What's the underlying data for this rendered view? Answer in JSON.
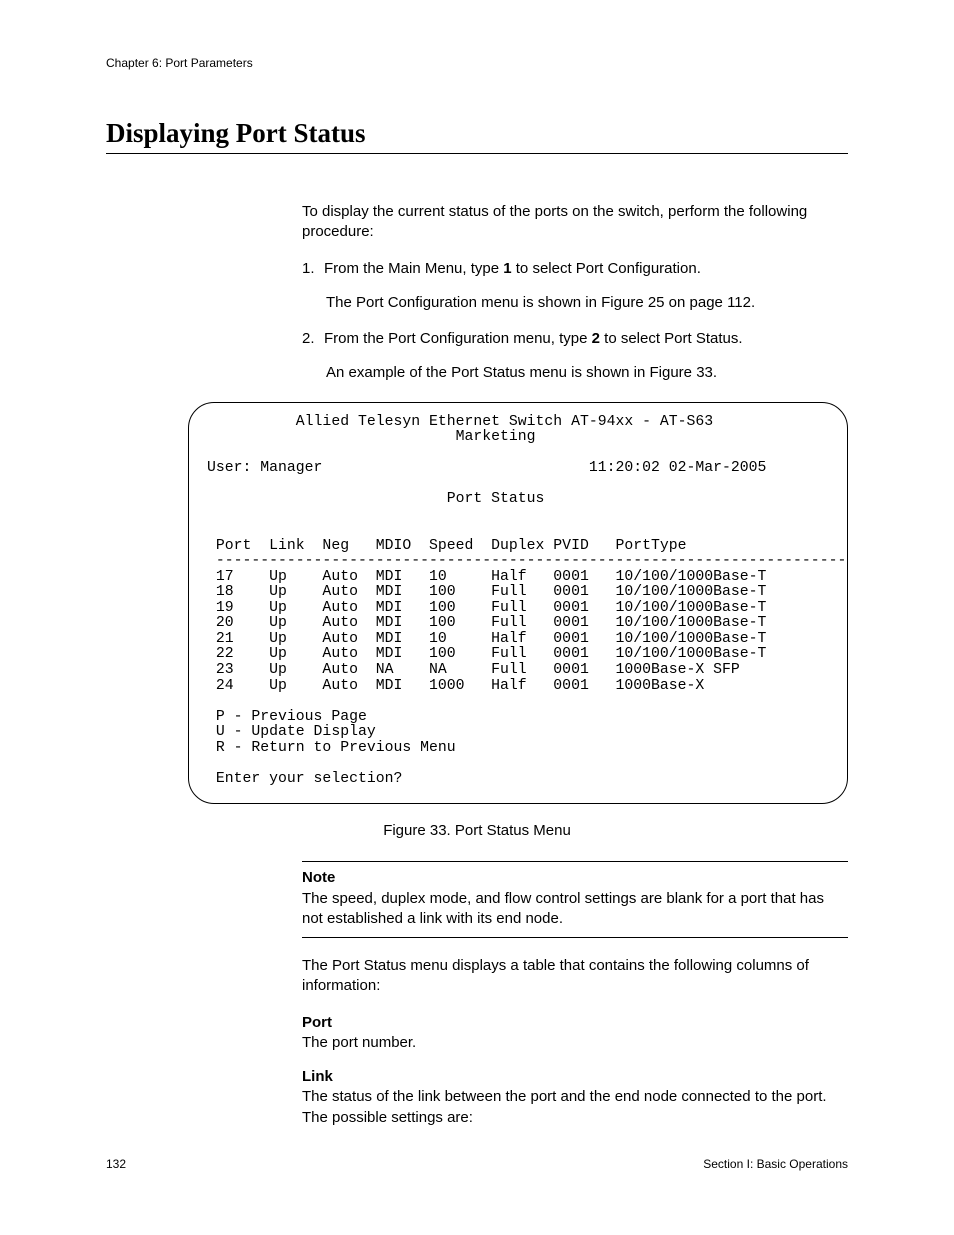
{
  "header": {
    "chapter": "Chapter 6: Port Parameters"
  },
  "title": "Displaying Port Status",
  "intro": "To display the current status of the ports on the switch, perform the following procedure:",
  "steps": {
    "s1_pre": "From the Main Menu, type ",
    "s1_bold": "1",
    "s1_post": " to select Port Configuration.",
    "s1_sub": "The Port Configuration menu is shown in Figure 25 on page 112.",
    "s2_pre": "From the Port Configuration menu, type ",
    "s2_bold": "2",
    "s2_post": " to select Port Status.",
    "s2_sub": "An example of the Port Status menu is shown in Figure 33."
  },
  "terminal": {
    "line1": "          Allied Telesyn Ethernet Switch AT-94xx - AT-S63",
    "line2": "                            Marketing",
    "user_label": "User: Manager",
    "datetime": "11:20:02 02-Mar-2005",
    "status_title": "                           Port Status",
    "header_row": " Port  Link  Neg   MDIO  Speed  Duplex PVID   PortType",
    "divider": " -----------------------------------------------------------------------",
    "rows": [
      " 17    Up    Auto  MDI   10     Half   0001   10/100/1000Base-T",
      " 18    Up    Auto  MDI   100    Full   0001   10/100/1000Base-T",
      " 19    Up    Auto  MDI   100    Full   0001   10/100/1000Base-T",
      " 20    Up    Auto  MDI   100    Full   0001   10/100/1000Base-T",
      " 21    Up    Auto  MDI   10     Half   0001   10/100/1000Base-T",
      " 22    Up    Auto  MDI   100    Full   0001   10/100/1000Base-T",
      " 23    Up    Auto  NA    NA     Full   0001   1000Base-X SFP",
      " 24    Up    Auto  MDI   1000   Half   0001   1000Base-X"
    ],
    "menu_p": " P - Previous Page",
    "menu_u": " U - Update Display",
    "menu_r": " R - Return to Previous Menu",
    "prompt": " Enter your selection?"
  },
  "fig_caption": "Figure 33. Port Status Menu",
  "note": {
    "title": "Note",
    "body": "The speed, duplex mode, and flow control settings are blank for a port that has not established a link with its end node."
  },
  "after_note": "The Port Status menu displays a table that contains the following columns of information:",
  "defs": {
    "port_term": "Port",
    "port_body": "The port number.",
    "link_term": "Link",
    "link_body": "The status of the link between the port and the end node connected to the port. The possible settings are:"
  },
  "footer": {
    "page": "132",
    "section": "Section I: Basic Operations"
  }
}
